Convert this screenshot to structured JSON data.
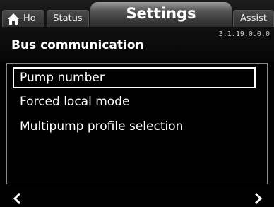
{
  "header": {
    "home_tab": {
      "label": "Ho",
      "icon": "home-icon"
    },
    "status_tab": {
      "label": "Status"
    },
    "settings_tab": {
      "label": "Settings"
    },
    "assist_tab": {
      "label": "Assist"
    },
    "version": "3.1.19.0.0.0"
  },
  "page": {
    "title": "Bus communication"
  },
  "menu": {
    "items": [
      {
        "label": "Pump number",
        "selected": true
      },
      {
        "label": "Forced local mode",
        "selected": false
      },
      {
        "label": "Multipump profile selection",
        "selected": false
      }
    ]
  },
  "footer": {
    "left_icon": "chevron-left-icon",
    "right_icon": "chevron-right-icon"
  },
  "colors": {
    "background": "#000000",
    "text": "#ffffff",
    "selection_border": "#ffffff",
    "panel_border": "#8a8a8a"
  }
}
